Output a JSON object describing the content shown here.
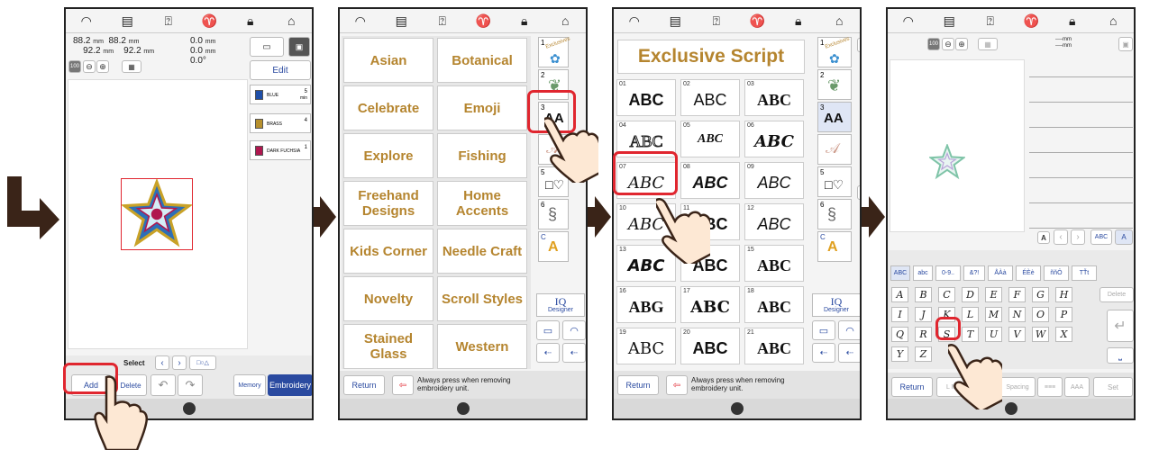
{
  "screen1": {
    "size1": "88.2",
    "size2": "92.2",
    "size3": "88.2",
    "size4": "92.2",
    "unit": "mm",
    "pos1": "0.0",
    "pos2": "0.0",
    "angle": "0.0°",
    "zoom": "100",
    "edit_label": "Edit",
    "threads": [
      {
        "name": "BLUE",
        "num": "5",
        "unit": "min",
        "color": "#1f4fa8"
      },
      {
        "name": "BRASS",
        "num": "4",
        "unit": "",
        "color": "#b7902d"
      },
      {
        "name": "DARK FUCHSIA",
        "num": "1",
        "unit": "",
        "color": "#b0174f"
      }
    ],
    "select_label": "Select",
    "add_label": "Add",
    "delete_label": "Delete",
    "memory_label": "Memory",
    "embroidery_label": "Embroidery"
  },
  "screen2": {
    "categories": [
      "Asian",
      "Botanical",
      "Celebrate",
      "Emoji",
      "Explore",
      "Fishing",
      "Freehand Designs",
      "Home Accents",
      "Kids Corner",
      "Needle Craft",
      "Novelty",
      "Scroll Styles",
      "Stained Glass",
      "Western"
    ],
    "tabs": [
      "1",
      "2",
      "3",
      "4",
      "5",
      "6",
      "C"
    ],
    "tab1_label": "Exclusives",
    "tab3_text": "AA",
    "iq_label": "IQ",
    "iq_sub": "Designer",
    "return_label": "Return",
    "notice": "Always press when removing embroidery unit."
  },
  "screen3": {
    "title": "Exclusive Script",
    "fonts": [
      {
        "n": "01",
        "t": "ABC"
      },
      {
        "n": "02",
        "t": "ABC"
      },
      {
        "n": "03",
        "t": "ABC"
      },
      {
        "n": "04",
        "t": "ABC"
      },
      {
        "n": "05",
        "t": "ABC"
      },
      {
        "n": "06",
        "t": "ABC"
      },
      {
        "n": "07",
        "t": "ABC"
      },
      {
        "n": "08",
        "t": "ABC"
      },
      {
        "n": "09",
        "t": "ABC"
      },
      {
        "n": "10",
        "t": "ABC"
      },
      {
        "n": "11",
        "t": "ABC"
      },
      {
        "n": "12",
        "t": "ABC"
      },
      {
        "n": "13",
        "t": "ABC"
      },
      {
        "n": "14",
        "t": "ABC"
      },
      {
        "n": "15",
        "t": "ABC"
      },
      {
        "n": "16",
        "t": "ABG"
      },
      {
        "n": "17",
        "t": "ABC"
      },
      {
        "n": "18",
        "t": "ABC"
      },
      {
        "n": "19",
        "t": "ABC"
      },
      {
        "n": "20",
        "t": "ABC"
      },
      {
        "n": "21",
        "t": "ABC"
      }
    ],
    "return_label": "Return",
    "notice": "Always press when removing embroidery unit."
  },
  "screen4": {
    "zoom": "100",
    "dim1": "----mm",
    "dim2": "----mm",
    "char_a": "A",
    "abc_a": "ABC",
    "a_btn": "A",
    "tabs": [
      "ABC",
      "abc",
      "0-9..",
      "&?!",
      "ÅÀà",
      "ÉÈè",
      "ñňÔ",
      "TŤt"
    ],
    "delete_label": "Delete",
    "keys_row1": [
      "A",
      "B",
      "C",
      "D",
      "E",
      "F",
      "G",
      "H"
    ],
    "keys_row2": [
      "I",
      "J",
      "K",
      "L",
      "M",
      "N",
      "O",
      "P"
    ],
    "keys_row3": [
      "Q",
      "R",
      "S",
      "T",
      "U",
      "V",
      "W",
      "X"
    ],
    "keys_row4": [
      "Y",
      "Z"
    ],
    "return_label": "Return",
    "lms_label": "L M S",
    "spacing_label": "Spacing",
    "set_label": "Set"
  }
}
